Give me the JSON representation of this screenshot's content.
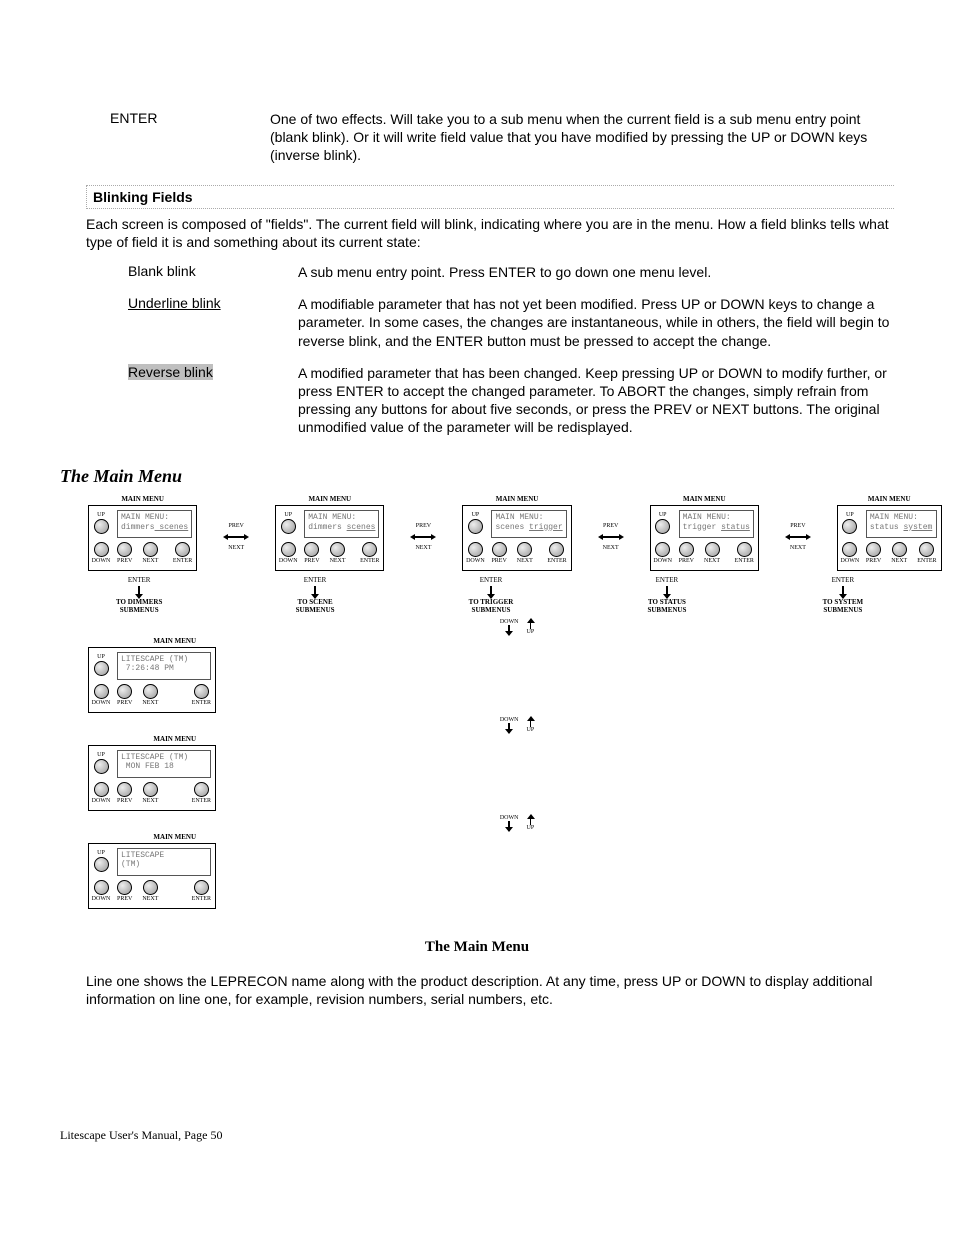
{
  "enter": {
    "term": "ENTER",
    "body": "One of two effects. Will take you to a sub menu when the current field is a sub menu entry point (blank blink). Or it will write field value that you have modified by pressing the UP or DOWN keys (inverse blink)."
  },
  "blinking": {
    "header": "Blinking Fields",
    "intro": "Each screen is composed of \"fields\". The current field will blink, indicating where you are in the menu. How a field blinks tells what type of field it is and something about its current state:",
    "blank": {
      "term": "Blank blink",
      "body": "A sub menu entry point. Press ENTER to go down one menu level."
    },
    "underline": {
      "term": "Underline blink",
      "body": "A modifiable parameter that has not yet been modified. Press UP or DOWN keys to change a parameter. In some cases, the changes are instantaneous, while in others, the field will begin to reverse blink, and the ENTER button must be pressed to accept the change."
    },
    "reverse": {
      "term": "Reverse blink",
      "body": "A modified parameter that has been changed. Keep pressing UP or DOWN to modify further, or press ENTER to accept the changed parameter. To ABORT the changes, simply refrain from pressing any buttons for about five seconds, or press the PREV or NEXT buttons. The original unmodified value of the parameter will be redisplayed."
    }
  },
  "main_heading": "The Main Menu",
  "menu_title": "MAIN MENU",
  "btn_labels": {
    "prev": "PREV",
    "next": "NEXT",
    "enter": "ENTER",
    "up": "UP",
    "down": "DOWN"
  },
  "panels_top": [
    {
      "l1": "MAIN MENU:",
      "l2p": "dimmers",
      "l2u": " scenes",
      "sub1": "TO DIMMERS",
      "sub2": "SUBMENUS"
    },
    {
      "l1": "MAIN MENU:",
      "l2p": "dimmers ",
      "l2u": "scenes",
      "sub1": "TO SCENE",
      "sub2": "SUBMENUS"
    },
    {
      "l1": "MAIN MENU:",
      "l2p": "scenes ",
      "l2u": "trigger",
      "sub1": "TO TRIGGER",
      "sub2": "SUBMENUS"
    },
    {
      "l1": "MAIN MENU:",
      "l2p": "trigger ",
      "l2u": "status",
      "sub1": "TO STATUS",
      "sub2": "SUBMENUS"
    },
    {
      "l1": "MAIN MENU:",
      "l2p": "status ",
      "l2u": "system",
      "sub1": "TO SYSTEM",
      "sub2": "SUBMENUS"
    }
  ],
  "panels_side": [
    {
      "l1": "LITESCAPE (TM)",
      "l2": " 7:26:48 PM"
    },
    {
      "l1": "LITESCAPE (TM)",
      "l2": " MON FEB 18"
    },
    {
      "l1": "LITESCAPE",
      "l2": "(TM)"
    }
  ],
  "caption": "The Main Menu",
  "body_text": "Line one shows the LEPRECON name along with the product description. At any time, press UP or DOWN to display additional information on line one, for example, revision numbers, serial numbers, etc.",
  "footer": "Litescape User's Manual, Page 50"
}
